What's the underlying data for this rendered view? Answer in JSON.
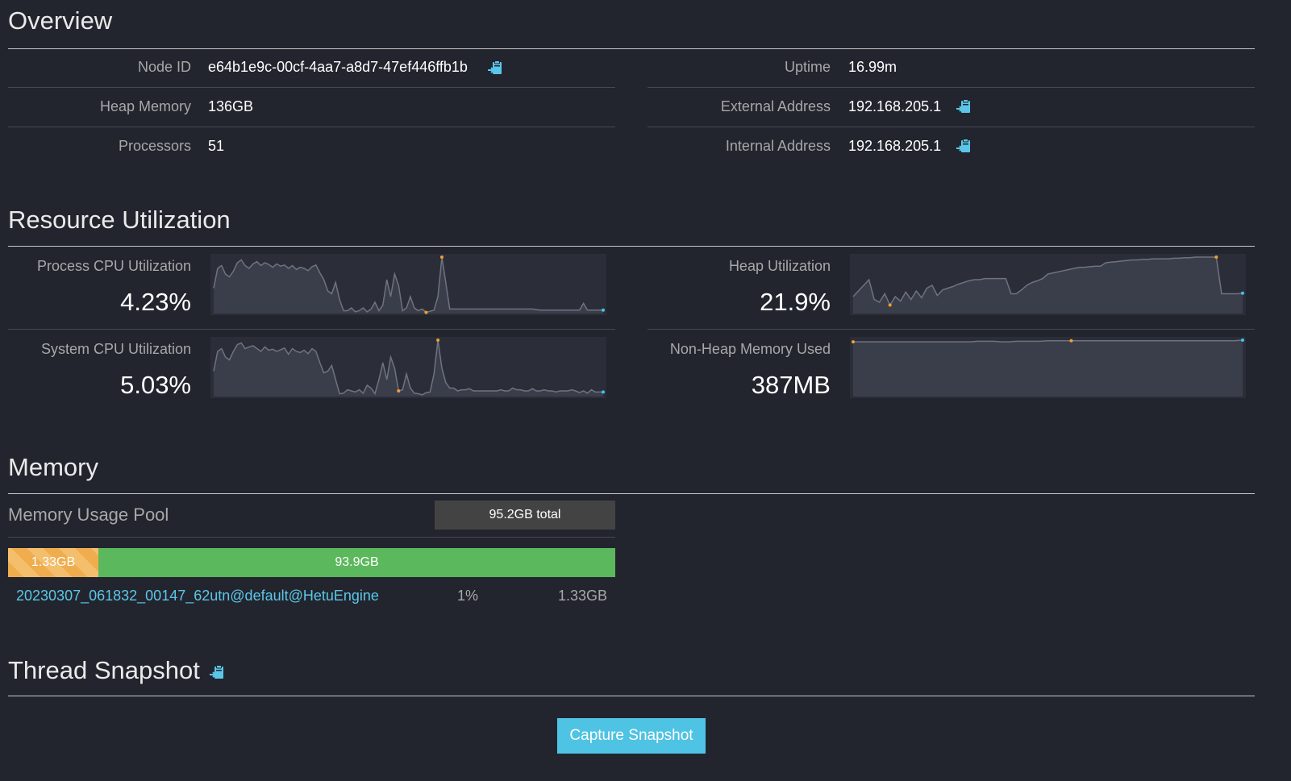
{
  "overview": {
    "title": "Overview",
    "left": [
      {
        "label": "Node ID",
        "value": "e64b1e9c-00cf-4aa7-a8d7-47ef446ffb1b",
        "copyable": true
      },
      {
        "label": "Heap Memory",
        "value": "136GB",
        "copyable": false
      },
      {
        "label": "Processors",
        "value": "51",
        "copyable": false
      }
    ],
    "right": [
      {
        "label": "Uptime",
        "value": "16.99m",
        "copyable": false
      },
      {
        "label": "External Address",
        "value": "192.168.205.1",
        "copyable": true
      },
      {
        "label": "Internal Address",
        "value": "192.168.205.1",
        "copyable": true
      }
    ]
  },
  "resources": {
    "title": "Resource Utilization",
    "process_cpu": {
      "label": "Process CPU Utilization",
      "value": "4.23%"
    },
    "system_cpu": {
      "label": "System CPU Utilization",
      "value": "5.03%"
    },
    "heap": {
      "label": "Heap Utilization",
      "value": "21.9%"
    },
    "nonheap": {
      "label": "Non-Heap Memory Used",
      "value": "387MB"
    }
  },
  "memory": {
    "title": "Memory",
    "pool_label": "Memory Usage Pool",
    "total": "95.2GB total",
    "used_label": "1.33GB",
    "used_fraction": 0.014,
    "free_label": "93.9GB",
    "queries": [
      {
        "id": "20230307_061832_00147_62utn@default@HetuEngine",
        "percent": "1%",
        "size": "1.33GB"
      }
    ]
  },
  "thread_snapshot": {
    "title": "Thread Snapshot",
    "button": "Capture Snapshot"
  },
  "colors": {
    "background": "#22252e",
    "accent": "#5bc7e8",
    "spark_fill": "#3a3e4b",
    "spark_line": "#6f7380",
    "marker_orange": "#f0a030",
    "marker_blue": "#3ec4f0",
    "bar_used": "#f0ad4e",
    "bar_free": "#5cb85c"
  },
  "icons": {
    "copy": "clipboard-copy-icon"
  },
  "chart_data": [
    {
      "type": "area",
      "title": "Process CPU Utilization",
      "ylim": [
        0,
        1
      ],
      "values": [
        0.45,
        0.8,
        0.85,
        0.7,
        0.65,
        0.75,
        0.9,
        0.95,
        0.85,
        0.8,
        0.88,
        0.92,
        0.85,
        0.9,
        0.87,
        0.82,
        0.88,
        0.84,
        0.86,
        0.8,
        0.85,
        0.78,
        0.82,
        0.8,
        0.76,
        0.83,
        0.86,
        0.72,
        0.6,
        0.4,
        0.35,
        0.55,
        0.25,
        0.05,
        0.05,
        0.1,
        0.03,
        0.05,
        0.1,
        0.03,
        0.08,
        0.2,
        0.05,
        0.15,
        0.6,
        0.3,
        0.7,
        0.5,
        0.05,
        0.1,
        0.3,
        0.1,
        0.05,
        0.08,
        0.02,
        0.04,
        0.06,
        0.3,
        1.0,
        0.55,
        0.08,
        0.08,
        0.08,
        0.08,
        0.08,
        0.08,
        0.08,
        0.08,
        0.08,
        0.08,
        0.08,
        0.08,
        0.08,
        0.08,
        0.08,
        0.08,
        0.08,
        0.08,
        0.08,
        0.08,
        0.08,
        0.08,
        0.07,
        0.06,
        0.06,
        0.06,
        0.06,
        0.06,
        0.06,
        0.06,
        0.06,
        0.06,
        0.06,
        0.06,
        0.18,
        0.06,
        0.06,
        0.06,
        0.06,
        0.06
      ],
      "min_index": 54,
      "max_index": 58
    },
    {
      "type": "area",
      "title": "System CPU Utilization",
      "ylim": [
        0,
        1
      ],
      "values": [
        0.45,
        0.8,
        0.85,
        0.7,
        0.65,
        0.8,
        0.92,
        0.95,
        0.85,
        0.88,
        0.9,
        0.85,
        0.8,
        0.88,
        0.82,
        0.84,
        0.8,
        0.83,
        0.86,
        0.75,
        0.85,
        0.8,
        0.78,
        0.82,
        0.76,
        0.85,
        0.8,
        0.6,
        0.42,
        0.45,
        0.55,
        0.3,
        0.05,
        0.06,
        0.12,
        0.1,
        0.08,
        0.12,
        0.06,
        0.2,
        0.15,
        0.05,
        0.3,
        0.6,
        0.3,
        0.7,
        0.5,
        0.1,
        0.12,
        0.4,
        0.15,
        0.06,
        0.05,
        0.03,
        0.07,
        0.08,
        0.4,
        1.0,
        0.5,
        0.25,
        0.15,
        0.15,
        0.1,
        0.12,
        0.12,
        0.14,
        0.1,
        0.1,
        0.1,
        0.1,
        0.1,
        0.1,
        0.1,
        0.12,
        0.1,
        0.1,
        0.15,
        0.12,
        0.12,
        0.1,
        0.1,
        0.14,
        0.1,
        0.1,
        0.12,
        0.1,
        0.1,
        0.08,
        0.1,
        0.1,
        0.1,
        0.12,
        0.1,
        0.07,
        0.1,
        0.06,
        0.12,
        0.08,
        0.08,
        0.08
      ],
      "min_index": 47,
      "max_index": 57
    },
    {
      "type": "area",
      "title": "Heap Utilization",
      "ylim": [
        0,
        1
      ],
      "values": [
        0.3,
        0.4,
        0.5,
        0.6,
        0.25,
        0.2,
        0.35,
        0.15,
        0.3,
        0.22,
        0.38,
        0.25,
        0.4,
        0.28,
        0.45,
        0.5,
        0.32,
        0.42,
        0.45,
        0.48,
        0.52,
        0.55,
        0.58,
        0.6,
        0.6,
        0.62,
        0.62,
        0.62,
        0.62,
        0.62,
        0.35,
        0.35,
        0.42,
        0.5,
        0.55,
        0.58,
        0.62,
        0.7,
        0.72,
        0.74,
        0.76,
        0.78,
        0.8,
        0.82,
        0.82,
        0.83,
        0.84,
        0.84,
        0.9,
        0.91,
        0.92,
        0.93,
        0.94,
        0.95,
        0.95,
        0.96,
        0.96,
        0.97,
        0.97,
        0.97,
        0.97,
        0.98,
        0.98,
        0.99,
        0.99,
        1.0,
        1.0,
        1.0,
        1.0,
        1.0,
        0.35,
        0.35,
        0.35,
        0.35,
        0.36
      ],
      "min_index": 7,
      "max_index": 69
    },
    {
      "type": "area",
      "title": "Non-Heap Memory Used",
      "ylim": [
        0,
        1
      ],
      "values": [
        0.97,
        0.97,
        0.97,
        0.97,
        0.97,
        0.97,
        0.97,
        0.97,
        0.97,
        0.97,
        0.97,
        0.97,
        0.97,
        0.97,
        0.97,
        0.97,
        0.98,
        0.98,
        0.98,
        0.97,
        0.97,
        0.98,
        0.98,
        0.98,
        0.98,
        0.99,
        0.99,
        0.99,
        0.99,
        0.99,
        0.99,
        0.99,
        0.99,
        0.99,
        0.99,
        0.99,
        0.99,
        0.99,
        0.99,
        0.99,
        0.99,
        0.99,
        0.99,
        0.99,
        0.99,
        0.99,
        0.99,
        0.99,
        0.99,
        0.99,
        1.0
      ],
      "min_index": 0,
      "max_index": 28
    }
  ]
}
